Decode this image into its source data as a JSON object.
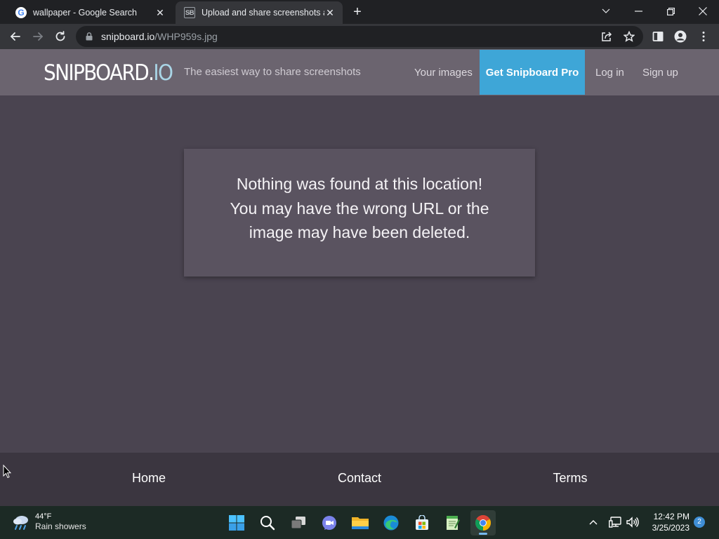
{
  "browser": {
    "tabs": [
      {
        "title": "wallpaper - Google Search",
        "favicon": "google-icon",
        "active": false
      },
      {
        "title": "Upload and share screenshots ar",
        "favicon": "snipboard-icon",
        "favicon_text": "SB",
        "active": true
      }
    ],
    "new_tab_label": "+",
    "address": {
      "domain": "snipboard.io",
      "path": "/WHP959s.jpg"
    }
  },
  "site": {
    "logo_main": "SNIPBOARD.",
    "logo_suffix": "IO",
    "tagline": "The easiest way to share screenshots",
    "nav": {
      "your_images": "Your images",
      "pro": "Get Snipboard Pro",
      "login": "Log in",
      "signup": "Sign up"
    },
    "message": {
      "line1": "Nothing was found at this location!",
      "line2": "You may have the wrong URL or the",
      "line3": "image may have been deleted."
    },
    "footer": {
      "home": "Home",
      "contact": "Contact",
      "terms": "Terms"
    }
  },
  "taskbar": {
    "weather": {
      "temp": "44°F",
      "condition": "Rain showers"
    },
    "apps": [
      "start-icon",
      "search-icon",
      "task-view-icon",
      "teams-chat-icon",
      "file-explorer-icon",
      "edge-icon",
      "store-icon",
      "notepad-icon",
      "chrome-icon"
    ],
    "clock": {
      "time": "12:42 PM",
      "date": "3/25/2023"
    },
    "notification_count": "2"
  },
  "colors": {
    "accent": "#3ea6d7",
    "nav_bg": "#6b646f",
    "page_bg": "#4a4450",
    "card_bg": "#5a5360",
    "footer_bg": "#3b3640"
  }
}
